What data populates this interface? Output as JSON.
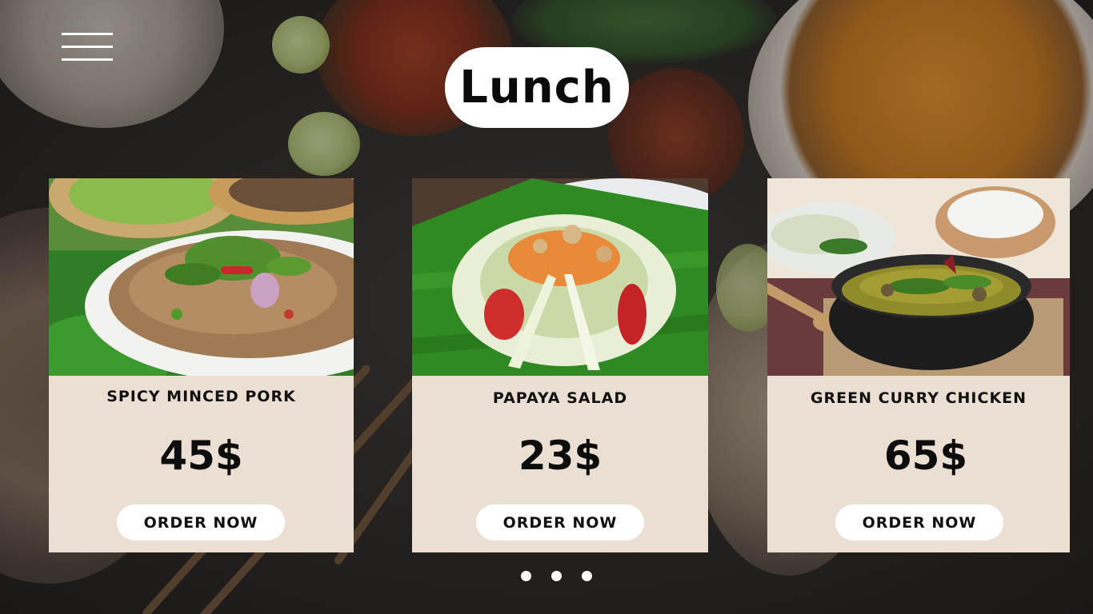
{
  "page": {
    "title": "Lunch"
  },
  "menu": {
    "icon": "hamburger-menu-icon"
  },
  "cards": [
    {
      "name": "SPICY MINCED PORK",
      "price": "45$",
      "button": "ORDER NOW",
      "image": "larb-dish-photo"
    },
    {
      "name": "PAPAYA SALAD",
      "price": "23$",
      "button": "ORDER NOW",
      "image": "papaya-salad-photo"
    },
    {
      "name": "GREEN CURRY CHICKEN",
      "price": "65$",
      "button": "ORDER NOW",
      "image": "green-curry-photo"
    }
  ],
  "pagination": {
    "count": 3,
    "active": 1
  },
  "colors": {
    "card_bg": "#ebdfd3",
    "pill_bg": "#ffffff",
    "text": "#111111"
  }
}
